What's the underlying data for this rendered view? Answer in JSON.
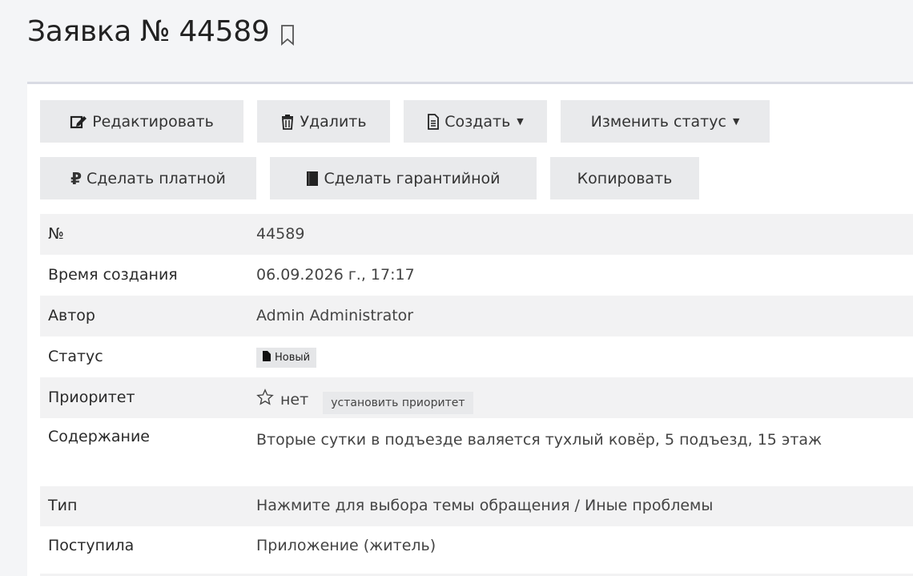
{
  "header": {
    "title": "Заявка № 44589"
  },
  "toolbar": {
    "edit_label": "Редактировать",
    "delete_label": "Удалить",
    "create_label": "Создать",
    "change_status_label": "Изменить статус",
    "make_paid_label": "Сделать платной",
    "make_warranty_label": "Сделать гарантийной",
    "copy_label": "Копировать"
  },
  "details": {
    "number": {
      "label": "№",
      "value": "44589"
    },
    "created": {
      "label": "Время создания",
      "value": "06.09.2026 г., 17:17"
    },
    "author": {
      "label": "Автор",
      "value": "Admin Administrator"
    },
    "status": {
      "label": "Статус",
      "value": "Новый"
    },
    "priority": {
      "label": "Приоритет",
      "value": "нет",
      "set_button": "установить приоритет"
    },
    "content": {
      "label": "Содержание",
      "value": "Вторые сутки в подъезде валяется тухлый ковёр, 5 подъезд, 15 этаж"
    },
    "type": {
      "label": "Тип",
      "value": "Нажмите для выбора темы обращения / Иные проблемы"
    },
    "source": {
      "label": "Поступила",
      "value": "Приложение (житель)"
    }
  }
}
